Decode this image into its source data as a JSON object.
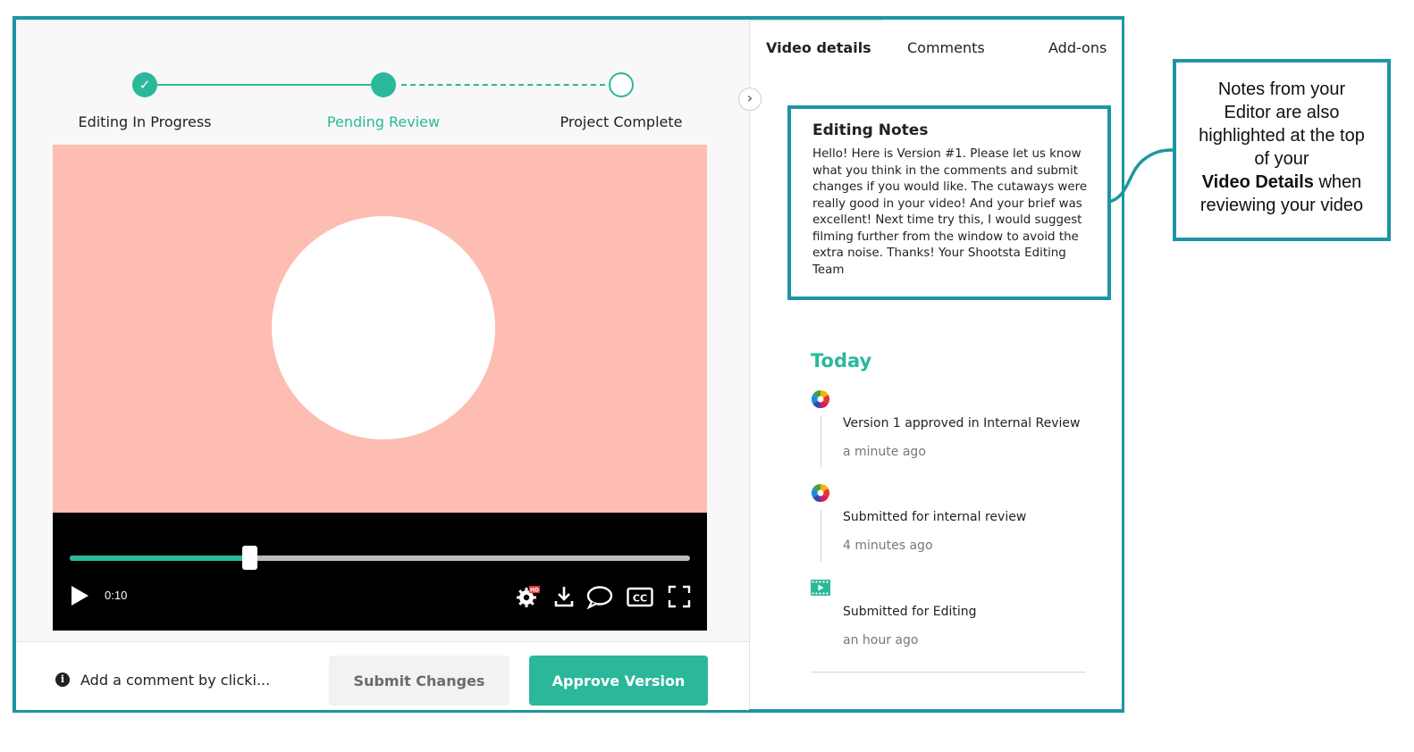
{
  "stepper": {
    "steps": [
      {
        "label": "Editing In Progress",
        "state": "done"
      },
      {
        "label": "Pending Review",
        "state": "current"
      },
      {
        "label": "Project Complete",
        "state": "upcoming"
      }
    ],
    "check_icon": "✓"
  },
  "player": {
    "time": "0:10",
    "progress_fraction": 0.29,
    "icons": [
      "play-icon",
      "settings-icon",
      "download-icon",
      "comment-icon",
      "closed-captions-icon",
      "fullscreen-icon"
    ],
    "cc_label": "CC",
    "settings_badge": "HD"
  },
  "actions": {
    "hint": "Add a comment by clicki...",
    "info_icon": "i",
    "submit_label": "Submit Changes",
    "approve_label": "Approve Version"
  },
  "panel": {
    "tabs": [
      "Video details",
      "Comments",
      "Add-ons"
    ],
    "collapse_icon": "›",
    "notes": {
      "title": "Editing Notes",
      "body": "Hello! Here is Version #1. Please let us know what you think in the comments and submit changes if you would like. The cutaways were really good in your video! And your brief was excellent! Next time try this, I would suggest filming further from the window to avoid the extra noise. Thanks! Your Shootsta Editing Team"
    },
    "today_label": "Today",
    "activities": [
      {
        "title": "Version 1 approved in Internal Review",
        "time": "a minute ago",
        "icon": "color-wheel-icon"
      },
      {
        "title": "Submitted for internal review",
        "time": "4 minutes ago",
        "icon": "color-wheel-icon"
      },
      {
        "title": "Submitted for Editing",
        "time": "an hour ago",
        "icon": "film-icon"
      }
    ]
  },
  "callout": {
    "line1": "Notes from your",
    "line2": "Editor are also",
    "line3": "highlighted at the top",
    "line4": "of your",
    "bold": "Video Details",
    "line5_tail": " when",
    "line6": "reviewing your video"
  },
  "colors": {
    "accent": "#2bb89a",
    "frame": "#1c96a2",
    "video_bg": "#fdbdb2"
  }
}
